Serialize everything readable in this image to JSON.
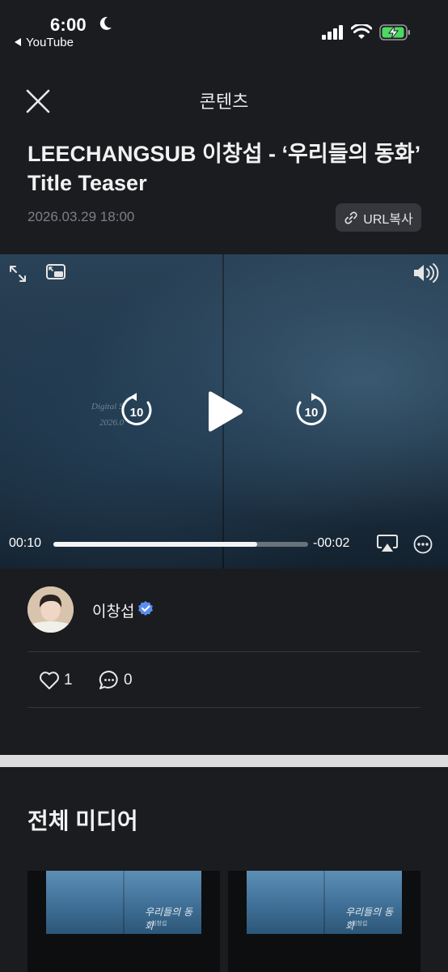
{
  "status_bar": {
    "time": "6:00",
    "back_app": "YouTube"
  },
  "header": {
    "title": "콘텐츠"
  },
  "post": {
    "title": "LEECHANGSUB 이창섭 - ‘우리들의 동화’ Title Teaser",
    "date": "2026.03.29 18:00",
    "url_button": "URL복사"
  },
  "video": {
    "elapsed": "00:10",
    "remaining": "-00:02",
    "progress": 0.8,
    "skip_seconds": "10",
    "book_text_line1": "Digital S",
    "book_text_line2": "2026.0"
  },
  "author": {
    "name": "이창섭"
  },
  "stats": {
    "likes": "1",
    "comments": "0"
  },
  "media": {
    "title": "전체 미디어",
    "thumbnails": [
      {
        "script": "우리들의 동화",
        "sub": "이창섭"
      },
      {
        "script": "우리들의 동화",
        "sub": "이창섭"
      }
    ]
  },
  "colors": {
    "background": "#1b1c20",
    "verified": "#5b8def",
    "url_button_bg": "#35373d"
  }
}
